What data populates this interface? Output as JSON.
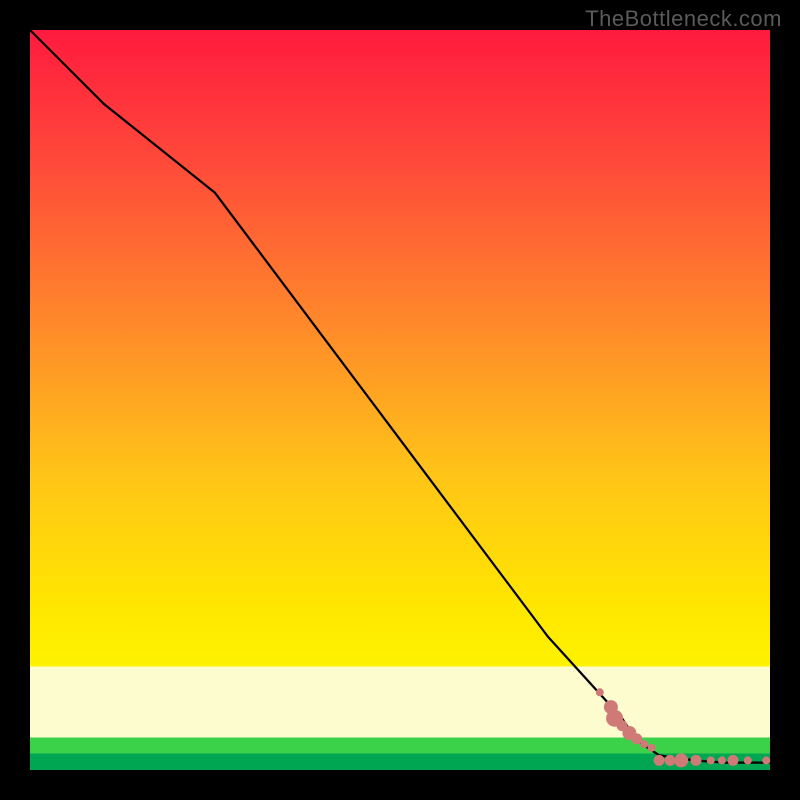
{
  "watermark": "TheBottleneck.com",
  "chart_data": {
    "type": "line",
    "title": "",
    "xlabel": "",
    "ylabel": "",
    "xlim": [
      0,
      100
    ],
    "ylim": [
      0,
      100
    ],
    "grid": false,
    "line": {
      "x": [
        0,
        10,
        25,
        40,
        55,
        70,
        80,
        82,
        85,
        88,
        91,
        94,
        97,
        100
      ],
      "y": [
        100,
        90,
        78,
        58,
        38,
        18,
        7,
        4,
        2,
        1.5,
        1.2,
        1.0,
        1.0,
        1.0
      ]
    },
    "markers": {
      "comment": "salmon-colored dots clustered near the floor where the curve flattens; sizes vary",
      "points": [
        {
          "x": 77.0,
          "y": 10.5,
          "size": "sm"
        },
        {
          "x": 78.5,
          "y": 8.5,
          "size": "lg"
        },
        {
          "x": 79.0,
          "y": 7.0,
          "size": "xl"
        },
        {
          "x": 80.0,
          "y": 6.0,
          "size": "md"
        },
        {
          "x": 81.0,
          "y": 5.0,
          "size": "lg"
        },
        {
          "x": 82.0,
          "y": 4.2,
          "size": "md"
        },
        {
          "x": 83.0,
          "y": 3.5,
          "size": "sm"
        },
        {
          "x": 84.0,
          "y": 3.0,
          "size": "sm"
        },
        {
          "x": 85.0,
          "y": 1.3,
          "size": "md"
        },
        {
          "x": 86.5,
          "y": 1.3,
          "size": "md"
        },
        {
          "x": 88.0,
          "y": 1.3,
          "size": "lg"
        },
        {
          "x": 90.0,
          "y": 1.3,
          "size": "md"
        },
        {
          "x": 92.0,
          "y": 1.3,
          "size": "sm"
        },
        {
          "x": 93.5,
          "y": 1.3,
          "size": "sm"
        },
        {
          "x": 95.0,
          "y": 1.3,
          "size": "md"
        },
        {
          "x": 97.0,
          "y": 1.3,
          "size": "sm"
        },
        {
          "x": 99.5,
          "y": 1.3,
          "size": "sm"
        }
      ],
      "color": "#d07a78"
    },
    "bands": [
      {
        "label": "gradient-red-orange-yellow",
        "y_from": 14,
        "y_to": 100
      },
      {
        "label": "pale-yellow-highlight",
        "y_from": 4.4,
        "y_to": 14
      },
      {
        "label": "green-band",
        "y_from": 0,
        "y_to": 4.4
      }
    ]
  }
}
